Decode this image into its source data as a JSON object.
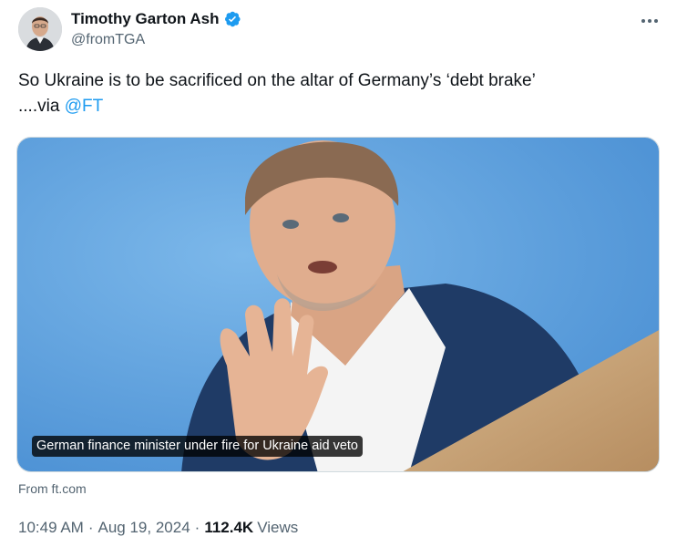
{
  "author": {
    "display_name": "Timothy Garton Ash",
    "handle": "@fromTGA",
    "verified": true
  },
  "tweet": {
    "text_line1": "So  Ukraine is to be sacrificed on the altar of Germany’s ‘debt brake’",
    "text_line2_prefix": "....via ",
    "mention": "@FT"
  },
  "card": {
    "caption": "German finance minister under fire for Ukraine aid veto",
    "source": "From ft.com"
  },
  "meta": {
    "time": "10:49 AM",
    "separator": "·",
    "date": "Aug 19, 2024",
    "views_count": "112.4K",
    "views_label": "Views"
  },
  "colors": {
    "accent": "#1d9bf0",
    "secondary_text": "#536471",
    "photo_background": "#5fa0dc"
  },
  "icons": {
    "verified": "verified-badge-icon",
    "more": "more-options-icon"
  }
}
